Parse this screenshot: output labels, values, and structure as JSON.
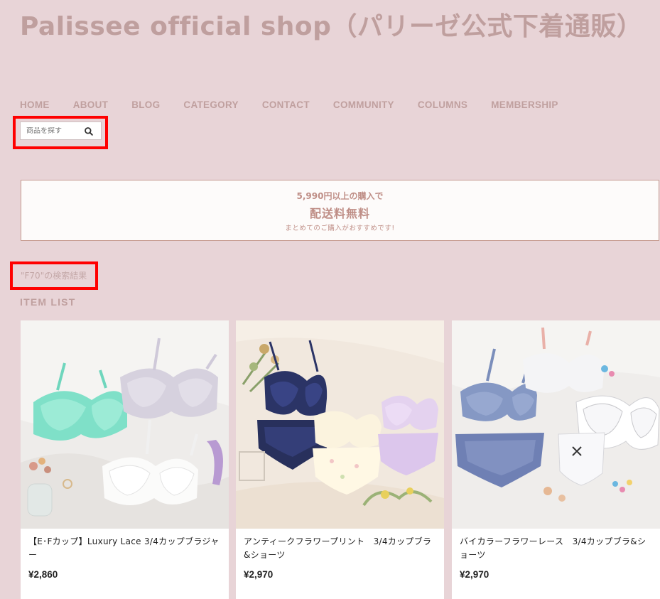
{
  "site": {
    "title": "Palissee official shop（パリーゼ公式下着通販）"
  },
  "nav": [
    "HOME",
    "ABOUT",
    "BLOG",
    "CATEGORY",
    "CONTACT",
    "COMMUNITY",
    "COLUMNS",
    "MEMBERSHIP"
  ],
  "search": {
    "placeholder": "商品を探す",
    "icon": "search-icon"
  },
  "banner": {
    "line1": "5,990円以上の購入で",
    "line2": "配送料無料",
    "line3": "まとめてのご購入がおすすめです!"
  },
  "search_result": "\"F70\"の検索結果",
  "item_list_title": "ITEM LIST",
  "products": [
    {
      "name": "【E･Fカップ】Luxury Lace 3/4カップブラジャー",
      "price": "¥2,860",
      "image": "mint-lilac-white-lace-bras"
    },
    {
      "name": "アンティークフラワープリント　3/4カップブラ&ショーツ",
      "price": "¥2,970",
      "image": "navy-floral-print-bra-sets"
    },
    {
      "name": "バイカラーフラワーレース　3/4カップブラ&ショーツ",
      "price": "¥2,970",
      "image": "blue-white-bicolor-bra-sets"
    }
  ],
  "colors": {
    "background": "#e8d4d7",
    "brand": "#bf9f9e",
    "banner_accent": "#bf8e86",
    "highlight": "#ff0000"
  }
}
